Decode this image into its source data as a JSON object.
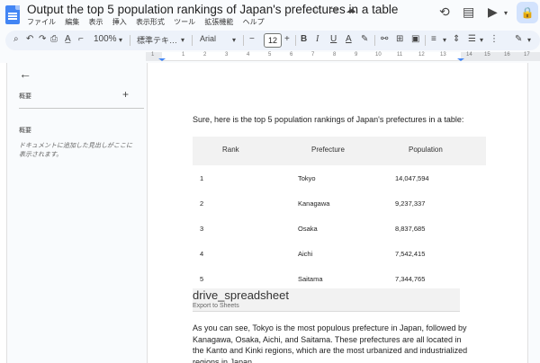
{
  "window": {
    "title": "Output the top 5 population rankings of Japan's prefectures in a table",
    "menu": [
      "ファイル",
      "編集",
      "表示",
      "挿入",
      "表示形式",
      "ツール",
      "拡張機能",
      "ヘルプ"
    ],
    "avatar_letter": "\u0000"
  },
  "toolbar": {
    "zoom": "100%",
    "style": "標準テキ…",
    "font": "Arial",
    "font_size": "12"
  },
  "outline": {
    "heading": "概要",
    "summary_label": "概要",
    "hint": "ドキュメントに追加した見出しがここに表示されます。"
  },
  "document": {
    "intro": "Sure, here is the top 5 population rankings of Japan's prefectures in a table:",
    "table": {
      "headers": [
        "Rank",
        "Prefecture",
        "Population"
      ],
      "rows": [
        [
          "1",
          "Tokyo",
          "14,047,594"
        ],
        [
          "2",
          "Kanagawa",
          "9,237,337"
        ],
        [
          "3",
          "Osaka",
          "8,837,685"
        ],
        [
          "4",
          "Aichi",
          "7,542,415"
        ],
        [
          "5",
          "Saitama",
          "7,344,765"
        ]
      ]
    },
    "chip": {
      "icon_name": "drive_spreadsheet",
      "label": "Export to Sheets"
    },
    "paragraph": "As you can see, Tokyo is the most populous prefecture in Japan, followed by Kanagawa, Osaka, Aichi, and Saitama. These prefectures are all located in the Kanto and Kinki regions, which are the most urbanized and industrialized regions in Japan."
  },
  "ruler": [
    "1",
    "1",
    "2",
    "3",
    "4",
    "5",
    "6",
    "7",
    "8",
    "9",
    "10",
    "11",
    "12",
    "13",
    "14",
    "15",
    "16",
    "17",
    "18"
  ]
}
